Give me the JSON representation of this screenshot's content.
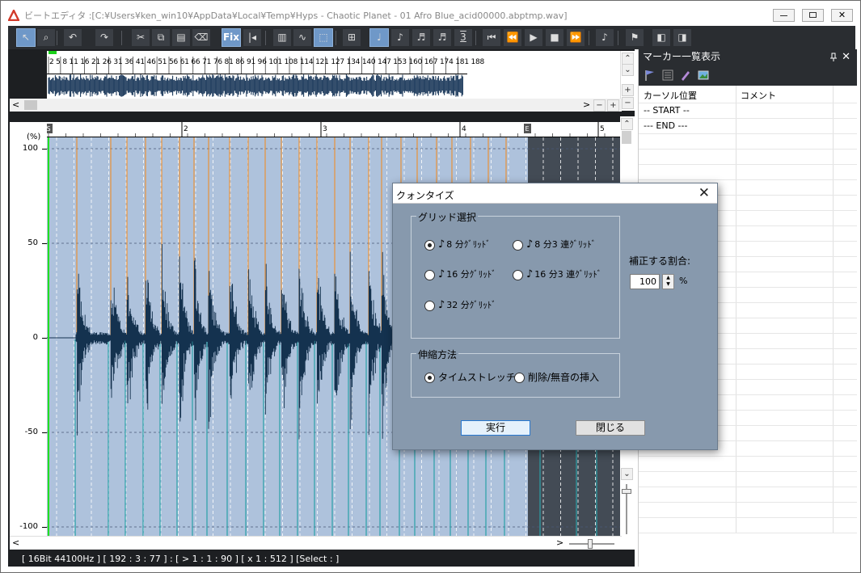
{
  "window": {
    "title": "ビートエディタ :[C:¥Users¥ken_win10¥AppData¥Local¥Temp¥Hyps - Chaotic Planet - 01 Afro Blue_acid00000.abptmp.wav]",
    "accent": "#d23a2a"
  },
  "toolbar": {
    "fix_label": "Fix",
    "three_label": "3",
    "icons": [
      "cursor-icon",
      "zoom-icon",
      "undo-icon",
      "redo-icon",
      "cut-icon",
      "copy-icon",
      "paste-icon",
      "erase-icon",
      "fix-icon",
      "snap-icon",
      "marker-list-icon",
      "waveform-icon",
      "select-icon",
      "quantize-icon",
      "quarter-note-icon",
      "eighth-note-icon",
      "sixteenth-note-icon",
      "thirtysecond-note-icon",
      "triplet-icon",
      "go-start-icon",
      "rewind-icon",
      "play-icon",
      "stop-icon",
      "fast-forward-icon",
      "metronome-icon",
      "flag-icon",
      "marker-prev-icon",
      "marker-next-icon"
    ]
  },
  "overview": {
    "ruler_text": "2 5 8 11 16 21 26 31 36 41 46 51 56 61 66 71 76 81 86 91 96 101 108 114 121 127 134 140 147 153 160 167 174 181 188"
  },
  "ruler": {
    "bars": [
      "S",
      "2",
      "3",
      "4",
      "E",
      "5"
    ]
  },
  "yaxis": {
    "unit": "(%)",
    "ticks": [
      "100",
      "50",
      "0",
      "-50",
      "-100"
    ]
  },
  "status": {
    "text": "[ 16Bit   44100Hz ]   [ 192 : 3 : 77 ] : [ > 1 : 1 : 90 ]   [ x 1 : 512 ]   [Select : ]"
  },
  "marker_panel": {
    "title": "マーカー一覧表示",
    "pin": "ᵖ",
    "close": "✕",
    "columns": [
      "カーソル位置",
      "コメント"
    ],
    "rows": [
      {
        "pos": "-- START --",
        "comment": ""
      },
      {
        "pos": "--- END ---",
        "comment": ""
      }
    ]
  },
  "dialog": {
    "title": "クォンタイズ",
    "grid_group_label": "グリッド選択",
    "grid_options": [
      {
        "label": "8 分ｸﾞﾘｯﾄﾞ",
        "note": "♪",
        "selected": true
      },
      {
        "label": "8 分3 連ｸﾞﾘｯﾄﾞ",
        "note": "♪",
        "selected": false
      },
      {
        "label": "16 分ｸﾞﾘｯﾄﾞ",
        "note": "♪",
        "selected": false
      },
      {
        "label": "16 分3 連ｸﾞﾘｯﾄﾞ",
        "note": "♪",
        "selected": false
      },
      {
        "label": "32 分ｸﾞﾘｯﾄﾞ",
        "note": "♪",
        "selected": false
      }
    ],
    "ratio_label": "補正する割合:",
    "ratio_value": "100",
    "ratio_unit": "%",
    "stretch_group_label": "伸縮方法",
    "stretch_options": [
      {
        "label": "タイムストレッチ",
        "selected": true
      },
      {
        "label": "削除/無音の挿入",
        "selected": false
      }
    ],
    "ok_label": "実行",
    "close_label": "閉じる"
  }
}
